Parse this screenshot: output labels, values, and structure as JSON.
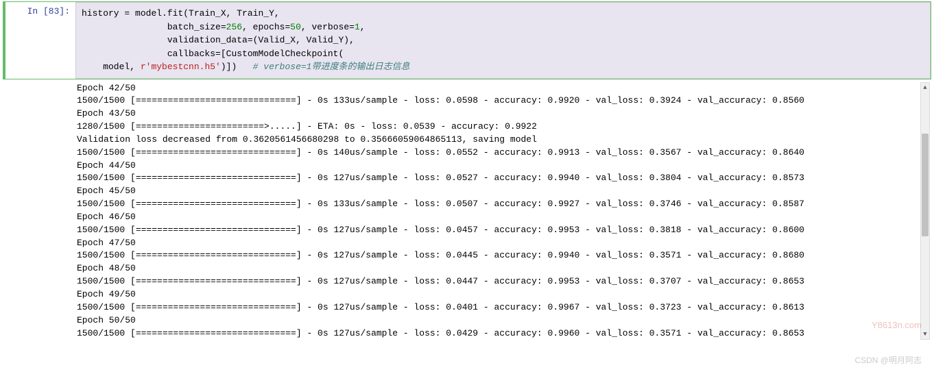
{
  "prompt": {
    "in_label": "In ",
    "open_bracket": "[",
    "num": "83",
    "close_bracket": "]:"
  },
  "code": {
    "l1_a": "history ",
    "l1_eq": "=",
    "l1_b": " model.fit(Train_X, Train_Y,",
    "l2_a": "                batch_size",
    "l2_eq1": "=",
    "l2_n1": "256",
    "l2_c1": ", epochs",
    "l2_eq2": "=",
    "l2_n2": "50",
    "l2_c2": ", verbose",
    "l2_eq3": "=",
    "l2_n3": "1",
    "l2_c3": ",",
    "l3": "                validation_data",
    "l3_eq": "=",
    "l3_b": "(Valid_X, Valid_Y),",
    "l4": "                callbacks",
    "l4_eq": "=",
    "l4_b": "[CustomModelCheckpoint(",
    "l5_a": "    model, ",
    "l5_r": "r",
    "l5_str": "'mybestcnn.h5'",
    "l5_b": ")])   ",
    "l5_comment": "# verbose=1带进度条的输出日志信息"
  },
  "output": {
    "lines": [
      "Epoch 42/50",
      "1500/1500 [==============================] - 0s 133us/sample - loss: 0.0598 - accuracy: 0.9920 - val_loss: 0.3924 - val_accuracy: 0.8560",
      "Epoch 43/50",
      "1280/1500 [========================>.....] - ETA: 0s - loss: 0.0539 - accuracy: 0.9922",
      "Validation loss decreased from 0.3620561456680298 to 0.35666059064865113, saving model",
      "1500/1500 [==============================] - 0s 140us/sample - loss: 0.0552 - accuracy: 0.9913 - val_loss: 0.3567 - val_accuracy: 0.8640",
      "Epoch 44/50",
      "1500/1500 [==============================] - 0s 127us/sample - loss: 0.0527 - accuracy: 0.9940 - val_loss: 0.3804 - val_accuracy: 0.8573",
      "Epoch 45/50",
      "1500/1500 [==============================] - 0s 133us/sample - loss: 0.0507 - accuracy: 0.9927 - val_loss: 0.3746 - val_accuracy: 0.8587",
      "Epoch 46/50",
      "1500/1500 [==============================] - 0s 127us/sample - loss: 0.0457 - accuracy: 0.9953 - val_loss: 0.3818 - val_accuracy: 0.8600",
      "Epoch 47/50",
      "1500/1500 [==============================] - 0s 127us/sample - loss: 0.0445 - accuracy: 0.9940 - val_loss: 0.3571 - val_accuracy: 0.8680",
      "Epoch 48/50",
      "1500/1500 [==============================] - 0s 127us/sample - loss: 0.0447 - accuracy: 0.9953 - val_loss: 0.3707 - val_accuracy: 0.8653",
      "Epoch 49/50",
      "1500/1500 [==============================] - 0s 127us/sample - loss: 0.0401 - accuracy: 0.9967 - val_loss: 0.3723 - val_accuracy: 0.8613",
      "Epoch 50/50",
      "1500/1500 [==============================] - 0s 127us/sample - loss: 0.0429 - accuracy: 0.9960 - val_loss: 0.3571 - val_accuracy: 0.8653"
    ]
  },
  "watermark1": "Y8613n.com",
  "watermark2": "CSDN @明月阿志"
}
